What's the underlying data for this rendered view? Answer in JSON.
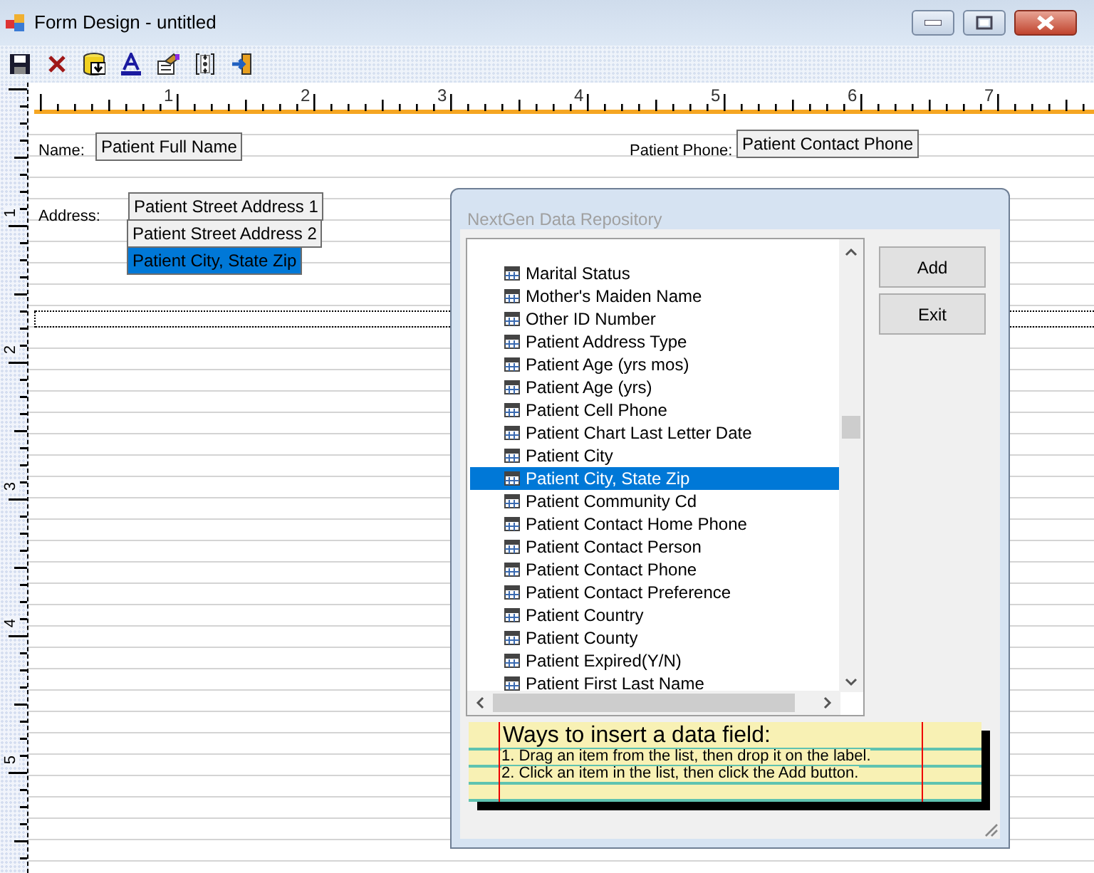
{
  "window": {
    "title": "Form Design - untitled"
  },
  "ruler": {
    "horizontal_marks": [
      "1",
      "2",
      "3",
      "4",
      "5",
      "6",
      "7"
    ],
    "vertical_marks": [
      "1",
      "2",
      "3",
      "4",
      "5"
    ]
  },
  "form": {
    "items": [
      {
        "kind": "label",
        "text": "Name:"
      },
      {
        "kind": "field",
        "text": "Patient Full Name",
        "selected": false
      },
      {
        "kind": "label",
        "text": "Patient Phone:"
      },
      {
        "kind": "field",
        "text": "Patient Contact Phone",
        "selected": false
      },
      {
        "kind": "label",
        "text": "Address:"
      },
      {
        "kind": "field",
        "text": "Patient Street Address 1",
        "selected": false
      },
      {
        "kind": "field",
        "text": "Patient Street Address 2",
        "selected": false
      },
      {
        "kind": "field",
        "text": "Patient City, State  Zip",
        "selected": true
      }
    ]
  },
  "dialog": {
    "title": "NextGen Data Repository",
    "items": [
      {
        "label": "Marital Status",
        "selected": false
      },
      {
        "label": "Mother's Maiden Name",
        "selected": false
      },
      {
        "label": "Other ID Number",
        "selected": false
      },
      {
        "label": "Patient Address Type",
        "selected": false
      },
      {
        "label": "Patient Age (yrs mos)",
        "selected": false
      },
      {
        "label": "Patient Age (yrs)",
        "selected": false
      },
      {
        "label": "Patient Cell Phone",
        "selected": false
      },
      {
        "label": "Patient Chart Last Letter Date",
        "selected": false
      },
      {
        "label": "Patient City",
        "selected": false
      },
      {
        "label": "Patient City, State  Zip",
        "selected": true
      },
      {
        "label": "Patient Community Cd",
        "selected": false
      },
      {
        "label": "Patient Contact Home Phone",
        "selected": false
      },
      {
        "label": "Patient Contact Person",
        "selected": false
      },
      {
        "label": "Patient Contact Phone",
        "selected": false
      },
      {
        "label": "Patient Contact Preference",
        "selected": false
      },
      {
        "label": "Patient Country",
        "selected": false
      },
      {
        "label": "Patient County",
        "selected": false
      },
      {
        "label": "Patient Expired(Y/N)",
        "selected": false
      },
      {
        "label": "Patient First Last Name",
        "selected": false
      }
    ],
    "buttons": [
      "Add",
      "Exit"
    ],
    "help": {
      "heading": "Ways to insert a data field:",
      "lines": [
        "1. Drag an item from the list, then drop it on the label.",
        "2. Click an item in the list, then click the Add button."
      ]
    }
  }
}
